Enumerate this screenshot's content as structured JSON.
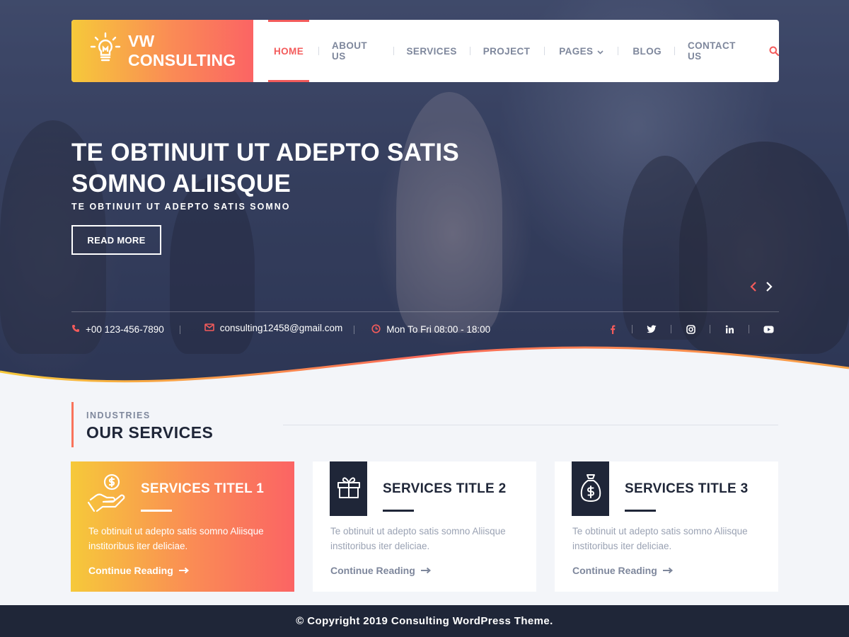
{
  "brand": {
    "name": "VW CONSULTING"
  },
  "nav": {
    "items": [
      {
        "label": "HOME",
        "active": true
      },
      {
        "label": "ABOUT US"
      },
      {
        "label": "SERVICES"
      },
      {
        "label": "PROJECT"
      },
      {
        "label": "PAGES",
        "dropdown": true
      },
      {
        "label": "BLOG"
      },
      {
        "label": "CONTACT US"
      }
    ],
    "search_icon": "search-icon"
  },
  "hero": {
    "title": "TE OBTINUIT UT ADEPTO SATIS SOMNO ALIISQUE",
    "subtitle": "TE OBTINUIT UT ADEPTO SATIS SOMNO",
    "button": "READ MORE"
  },
  "contact": {
    "phone": "+00 123-456-7890",
    "email": "consulting12458@gmail.com",
    "hours": "Mon To Fri 08:00 - 18:00"
  },
  "socials": [
    "facebook-icon",
    "twitter-icon",
    "instagram-icon",
    "linkedin-icon",
    "youtube-icon"
  ],
  "section": {
    "kicker": "INDUSTRIES",
    "title": "OUR SERVICES"
  },
  "services": [
    {
      "title": "SERVICES TITEL 1",
      "text": "Te obtinuit ut adepto satis somno Aliisque institoribus iter deliciae.",
      "link": "Continue Reading",
      "icon": "hand-coin-icon"
    },
    {
      "title": "SERVICES TITLE 2",
      "text": "Te obtinuit ut adepto satis somno Aliisque institoribus iter deliciae.",
      "link": "Continue Reading",
      "icon": "gift-icon"
    },
    {
      "title": "SERVICES TITLE 3",
      "text": "Te obtinuit ut adepto satis somno Aliisque institoribus iter deliciae.",
      "link": "Continue Reading",
      "icon": "money-bag-icon"
    }
  ],
  "footer": {
    "copyright": "© Copyright 2019 Consulting WordPress Theme."
  },
  "colors": {
    "accent": "#f35b5b",
    "gradient_start": "#f6c93a",
    "gradient_end": "#fb6464",
    "dark": "#1f2638"
  }
}
